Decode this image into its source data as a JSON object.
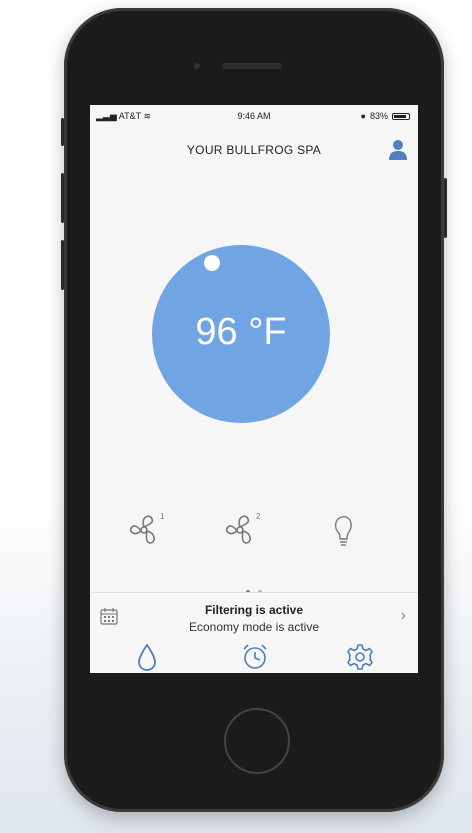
{
  "status_bar": {
    "carrier": "AT&T",
    "time": "9:46 AM",
    "battery_percent": "83%",
    "battery_level": 0.83
  },
  "header": {
    "title": "YOUR BULLFROG SPA"
  },
  "temperature": {
    "value": "96 °F"
  },
  "controls": [
    {
      "icon": "fan-icon",
      "badge": "1"
    },
    {
      "icon": "fan-icon",
      "badge": "2"
    },
    {
      "icon": "light-bulb-icon"
    }
  ],
  "pager": {
    "pages": 2,
    "active": 0
  },
  "status_row": {
    "primary": "Filtering is active",
    "secondary": "Economy mode is active"
  },
  "tabs": [
    {
      "icon": "water-drop-icon"
    },
    {
      "icon": "alarm-clock-icon"
    },
    {
      "icon": "gear-icon"
    }
  ],
  "colors": {
    "accent": "#70a4e2",
    "icon": "#4f7fbf"
  }
}
